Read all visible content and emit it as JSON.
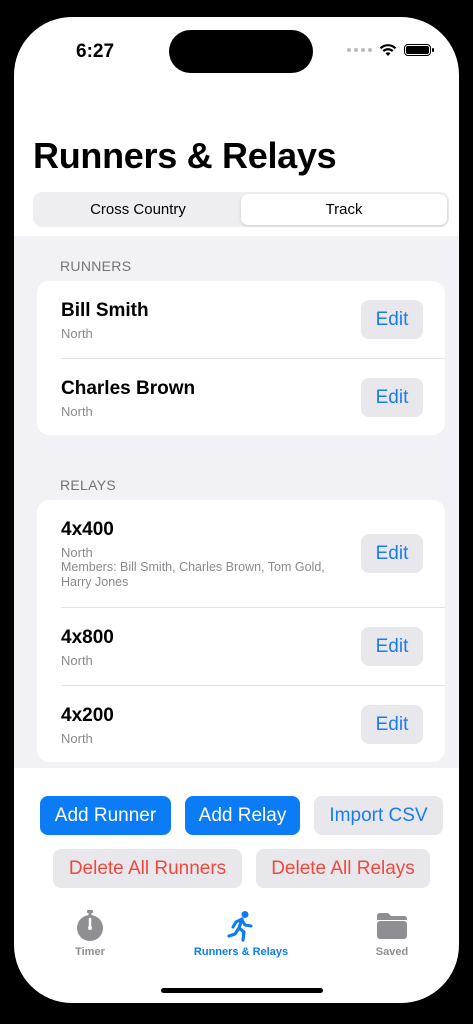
{
  "status_bar": {
    "time": "6:27"
  },
  "page_title": "Runners & Relays",
  "segments": [
    "Cross Country",
    "Track"
  ],
  "selected_segment": "Track",
  "runners_section": {
    "header": "RUNNERS",
    "items": [
      {
        "name": "Bill Smith",
        "team": "North",
        "edit_label": "Edit"
      },
      {
        "name": "Charles Brown",
        "team": "North",
        "edit_label": "Edit"
      }
    ]
  },
  "relays_section": {
    "header": "RELAYS",
    "items": [
      {
        "name": "4x400",
        "team": "North",
        "members": "Members: Bill Smith, Charles Brown, Tom Gold, Harry Jones",
        "edit_label": "Edit"
      },
      {
        "name": "4x800",
        "team": "North",
        "edit_label": "Edit"
      },
      {
        "name": "4x200",
        "team": "North",
        "edit_label": "Edit"
      }
    ]
  },
  "actions": {
    "add_runner": "Add Runner",
    "add_relay": "Add Relay",
    "import_csv": "Import CSV",
    "delete_all_runners": "Delete All Runners",
    "delete_all_relays": "Delete All Relays"
  },
  "tabs": [
    {
      "label": "Timer",
      "icon": "stopwatch-icon"
    },
    {
      "label": "Runners & Relays",
      "icon": "runner-icon"
    },
    {
      "label": "Saved",
      "icon": "folder-icon"
    }
  ],
  "selected_tab": "Runners & Relays",
  "colors": {
    "accent": "#0b7cf5",
    "destructive": "#f0483d",
    "inactive_tab": "#8e8e93"
  }
}
